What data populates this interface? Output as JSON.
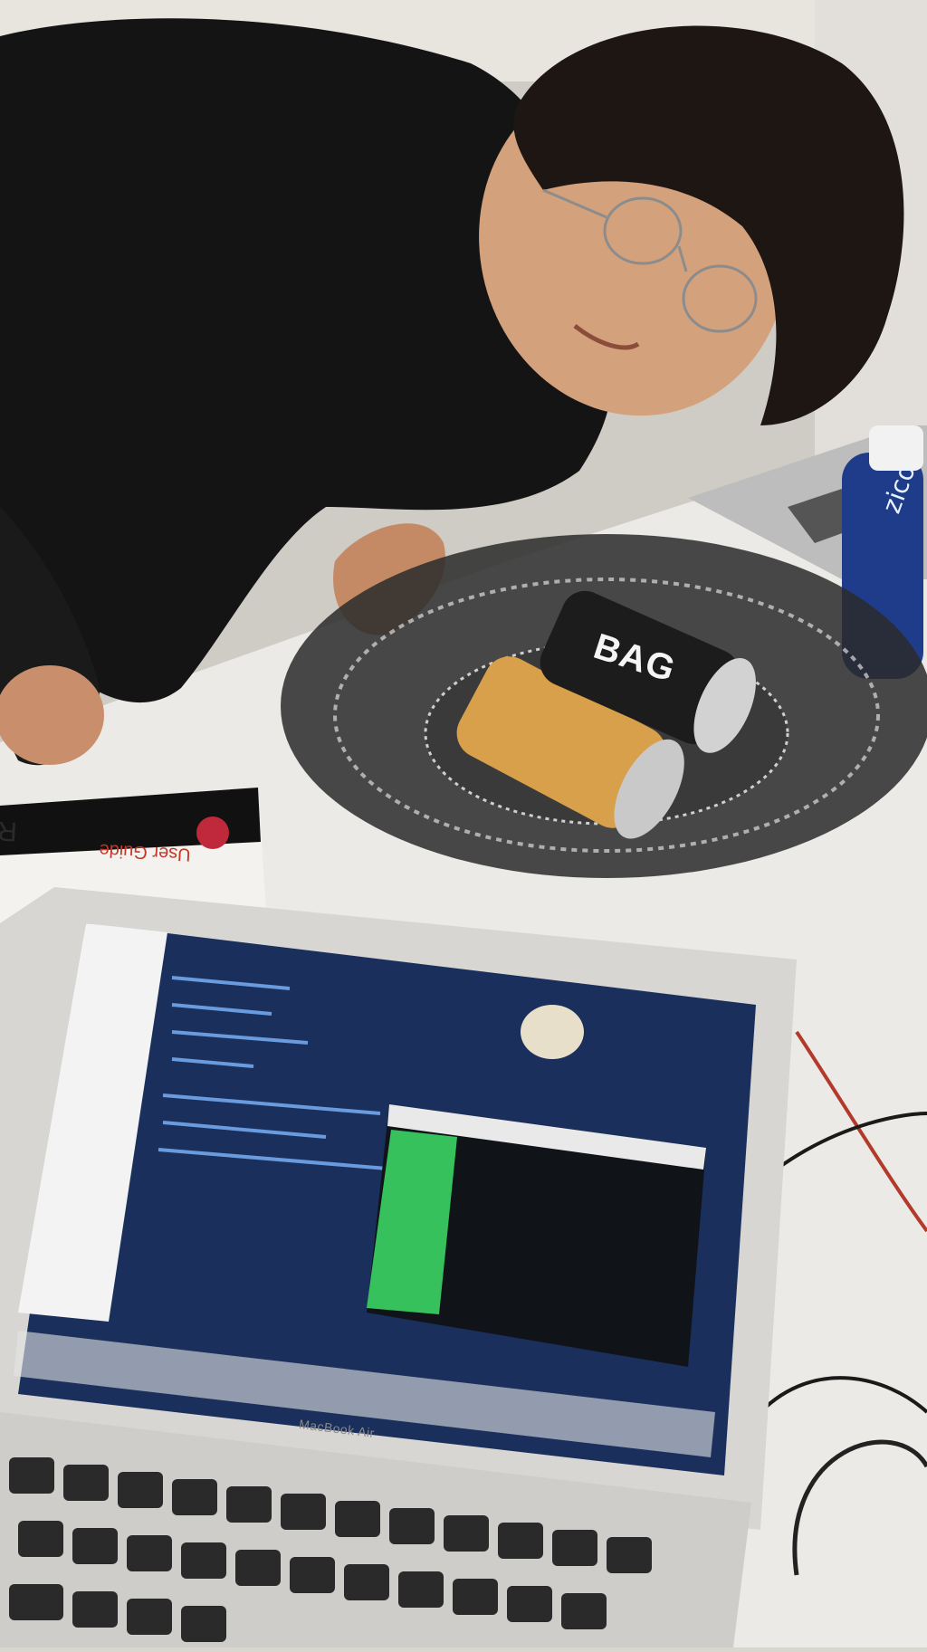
{
  "photo": {
    "description_free": true
  },
  "book": {
    "title": "Raspberry Pi",
    "subtitle": "User Guide"
  },
  "can": {
    "brand_text": "BAG"
  },
  "bottle": {
    "brand_text": "zico"
  },
  "laptop": {
    "model_label": "MacBook Air"
  },
  "colors": {
    "background": "#d9d6d0",
    "table": "#eceae6",
    "shirt": "#141414",
    "screen_editor": "#1a2f5c",
    "terminal_text": "#3ee06a",
    "laptop_body": "#d8d6d2"
  }
}
